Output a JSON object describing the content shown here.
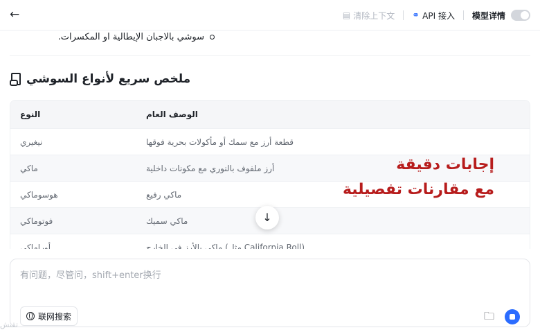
{
  "topbar": {
    "back_icon": "arrow-left-icon",
    "clear_context": "清除上下文",
    "api_access": "API 接入",
    "model_details": "模型详情",
    "toggle_on": false
  },
  "content": {
    "bullet_text": "سوشي بالاجبان الإيطالية او المكسرات.",
    "heading": "ملخص سريع لأنواع السوشي",
    "heading_icon": "scroll-icon",
    "table": {
      "headers": [
        "النوع",
        "الوصف العام"
      ],
      "rows": [
        [
          "نيغيري",
          "قطعة أرز مع سمك أو مأكولات بحرية فوقها"
        ],
        [
          "ماكي",
          "أرز ملفوف بالنوري مع مكونات داخلية"
        ],
        [
          "هوسوماكي",
          "ماكي رفيع"
        ],
        [
          "فوتوماكي",
          "ماكي سميك"
        ],
        [
          "أوراماكي",
          "ماكي بالأرز في الخارج (مثل California Roll)"
        ]
      ]
    },
    "overlay_line1": "إجابات دقيقة",
    "overlay_line2": "مع مقارنات تفصيلية",
    "overlay_color": "#b71c1c"
  },
  "composer": {
    "placeholder": "有问题，尽管问，shift+enter换行",
    "web_search": "联网搜索",
    "send_color": "#2b6cff"
  },
  "footer_faint": "تقنش"
}
